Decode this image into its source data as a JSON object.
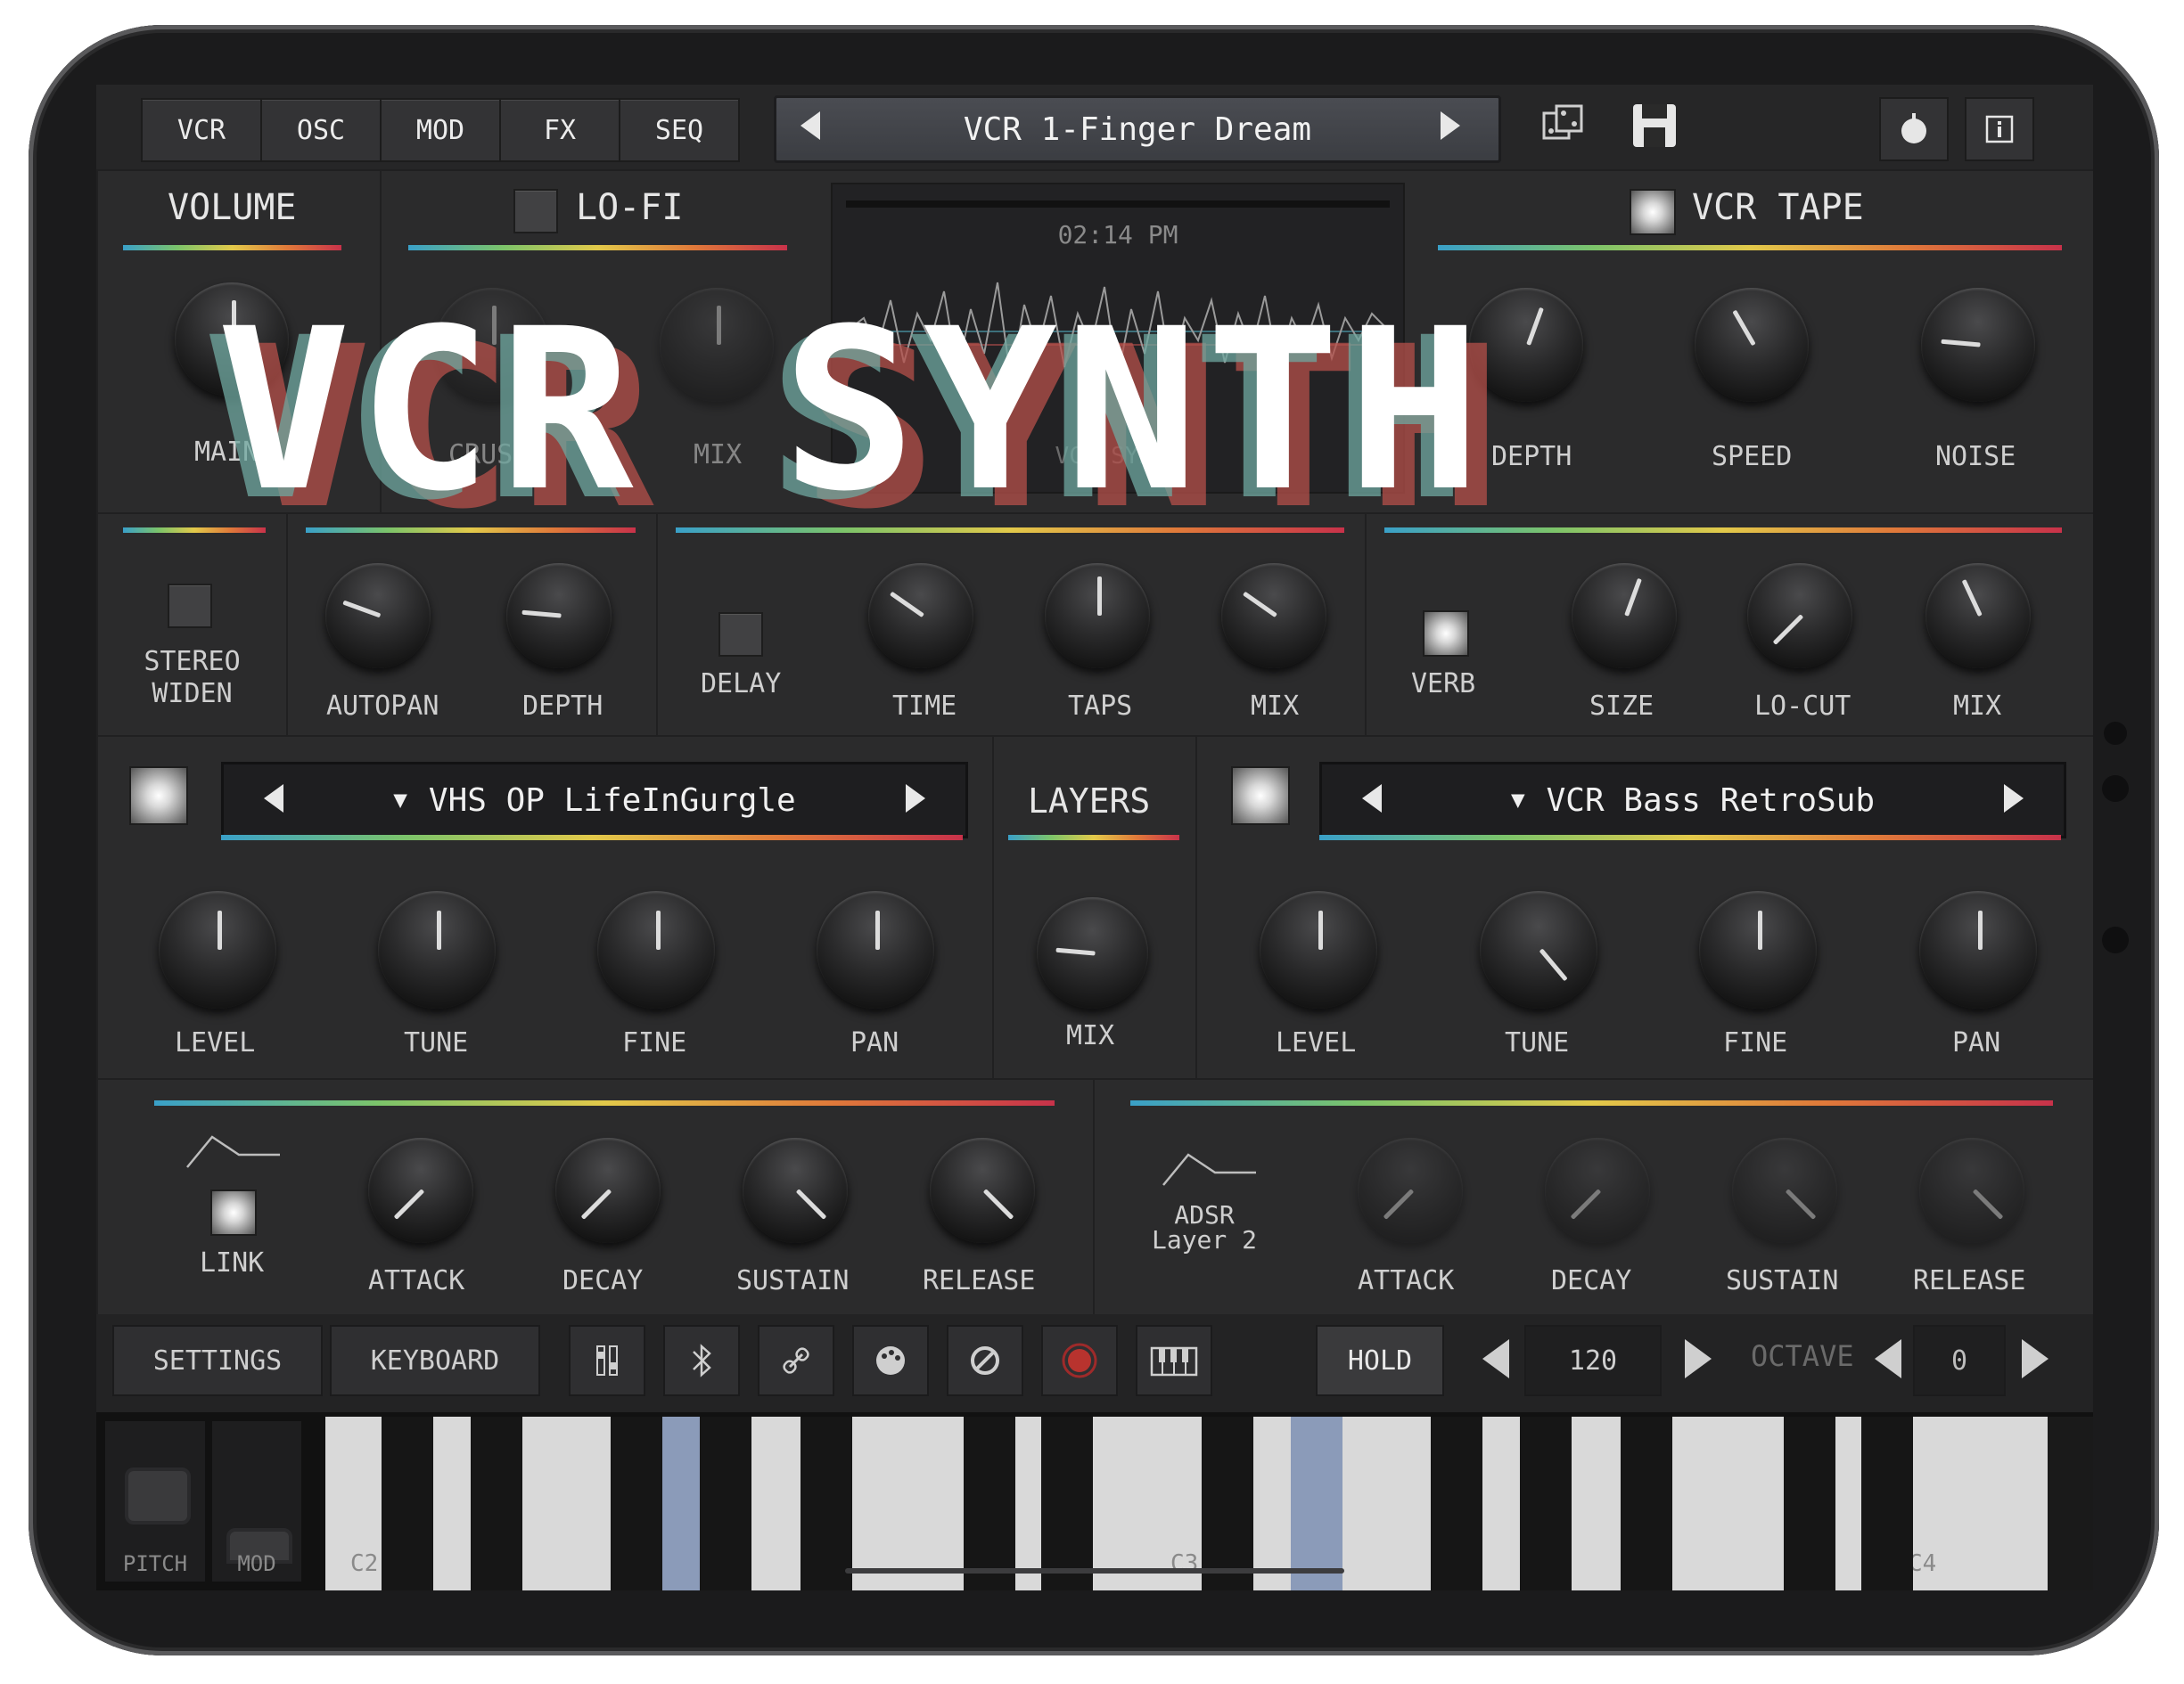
{
  "app": {
    "title": "VCR SYNTH"
  },
  "tabs": [
    "VCR",
    "OSC",
    "MOD",
    "FX",
    "SEQ"
  ],
  "preset": {
    "name": "VCR 1-Finger Dream"
  },
  "sections": {
    "volume": {
      "title": "VOLUME",
      "knob_label": "MAIN"
    },
    "lofi": {
      "title": "LO-FI",
      "knobs": [
        "CRUSH",
        "MIX"
      ]
    },
    "display": {
      "time": "02:14 PM",
      "caption": "VCR SYNTH"
    },
    "vcrtape": {
      "title": "VCR TAPE",
      "knobs": [
        "DEPTH",
        "SPEED",
        "NOISE"
      ]
    }
  },
  "fx": {
    "stereo_widen": "STEREO\nWIDEN",
    "autopan": "AUTOPAN",
    "depth": "DEPTH",
    "delay": "DELAY",
    "time": "TIME",
    "taps": "TAPS",
    "delay_mix": "MIX",
    "verb": "VERB",
    "size": "SIZE",
    "locut": "LO-CUT",
    "verb_mix": "MIX"
  },
  "layers": {
    "title": "LAYERS",
    "mix_label": "MIX",
    "layer1": {
      "preset": "VHS OP LifeInGurgle",
      "knobs": [
        "LEVEL",
        "TUNE",
        "FINE",
        "PAN"
      ]
    },
    "layer2": {
      "preset": "VCR Bass RetroSub",
      "knobs": [
        "LEVEL",
        "TUNE",
        "FINE",
        "PAN"
      ]
    }
  },
  "envelope": {
    "link_label": "LINK",
    "adsr_layer2": "ADSR\nLayer 2",
    "knobs": [
      "ATTACK",
      "DECAY",
      "SUSTAIN",
      "RELEASE"
    ]
  },
  "bottom": {
    "settings": "SETTINGS",
    "keyboard": "KEYBOARD",
    "hold": "HOLD",
    "tempo": "120",
    "octave_label": "OCTAVE",
    "octave_value": "0"
  },
  "keyboard": {
    "pitch": "PITCH",
    "mod": "MOD",
    "labels": [
      "C2",
      "C3",
      "C4"
    ]
  },
  "colors": {
    "accent_key": "#8b9bb9",
    "rainbow": [
      "#3aa0c8",
      "#7cc46a",
      "#e2c94a",
      "#e07a3a",
      "#c8324a"
    ],
    "logo_shadow_teal": "#6fa8a0",
    "logo_shadow_red": "#b5504a"
  },
  "icons": [
    "dice-icon",
    "save-icon",
    "power-knob-icon",
    "info-icon",
    "mixer-icon",
    "bluetooth-icon",
    "link-icon",
    "palette-icon",
    "disabled-icon",
    "record-icon",
    "piano-icon"
  ]
}
